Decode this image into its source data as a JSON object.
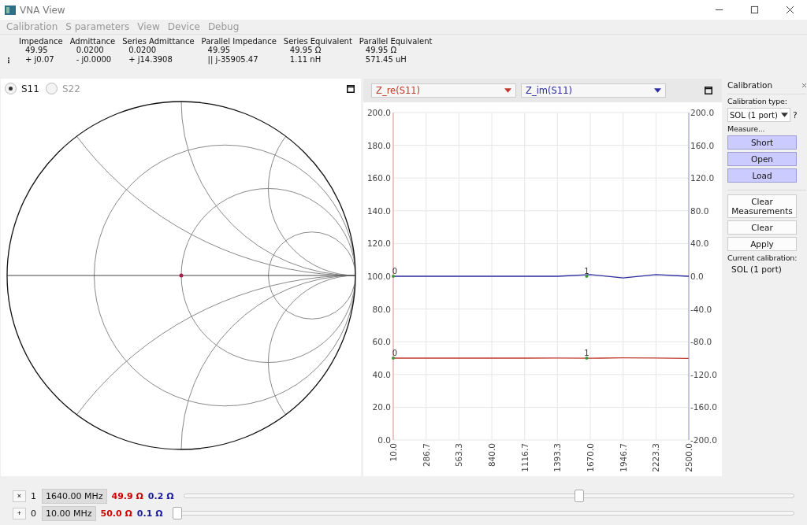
{
  "window": {
    "title": "VNA View"
  },
  "menu": [
    "Calibration",
    "S parameters",
    "View",
    "Device",
    "Debug"
  ],
  "readout": {
    "handle": "⋮",
    "columns": [
      {
        "header": "Impedance",
        "line_1": "49.95",
        "line_2": "+ j0.07"
      },
      {
        "header": "Admittance",
        "line_1": "0.0200",
        "line_2": "- j0.0000"
      },
      {
        "header": "Series Admittance",
        "line_1": "0.0200",
        "line_2": "+ j14.3908"
      },
      {
        "header": "Parallel Impedance",
        "line_1": "49.95",
        "line_2": "|| j-35905.47"
      },
      {
        "header": "Series Equivalent",
        "line_1": "49.95 Ω",
        "line_2": "1.11 nH"
      },
      {
        "header": "Parallel Equivalent",
        "line_1": "49.95 Ω",
        "line_2": "571.45 uH"
      }
    ]
  },
  "smith": {
    "ports": [
      {
        "label": "S11",
        "selected": true
      },
      {
        "label": "S22",
        "selected": false
      }
    ]
  },
  "graph": {
    "real_plot": {
      "chart_data": {
        "type": "line",
        "grid": true,
        "x": [
          10,
          286.7,
          563.3,
          840,
          1116.7,
          1393.3,
          1670,
          1946.7,
          2223.3,
          2500
        ],
        "xticks": [
          {
            "value": 10,
            "label": "10.0"
          },
          {
            "value": 286.7,
            "label": "286.7"
          },
          {
            "value": 563.3,
            "label": "563.3"
          },
          {
            "value": 840,
            "label": "840.0"
          },
          {
            "value": 1116.7,
            "label": "1116.7"
          },
          {
            "value": 1393.3,
            "label": "1393.3"
          },
          {
            "value": 1670,
            "label": "1670.0"
          },
          {
            "value": 1946.7,
            "label": "1946.7"
          },
          {
            "value": 2223.3,
            "label": "2223.3"
          },
          {
            "value": 2500,
            "label": "2500.0"
          }
        ],
        "xlim": [
          10,
          2500
        ],
        "ylim": [
          0,
          200
        ],
        "yticks": [
          {
            "value": 0,
            "label": "0.0"
          },
          {
            "value": 20,
            "label": "20.0"
          },
          {
            "value": 40,
            "label": "40.0"
          },
          {
            "value": 60,
            "label": "60.0"
          },
          {
            "value": 80,
            "label": "80.0"
          },
          {
            "value": 100,
            "label": "100.0"
          },
          {
            "value": 120,
            "label": "120.0"
          },
          {
            "value": 140,
            "label": "140.0"
          },
          {
            "value": 160,
            "label": "160.0"
          },
          {
            "value": 180,
            "label": "180.0"
          },
          {
            "value": 200,
            "label": "200.0"
          }
        ],
        "series": [
          {
            "name": "Z_re(S11)",
            "color": "#c0392b",
            "values": [
              50,
              50,
              50,
              50,
              50,
              50.1,
              49.9,
              50.2,
              50.1,
              49.8
            ]
          }
        ],
        "annotations": [
          {
            "x": 10,
            "y": 50,
            "text": "0"
          },
          {
            "x": 1640,
            "y": 50,
            "text": "1"
          }
        ]
      }
    },
    "imag_plot": {
      "chart_data": {
        "type": "line",
        "x": [
          10,
          286.7,
          563.3,
          840,
          1116.7,
          1393.3,
          1670,
          1946.7,
          2223.3,
          2500
        ],
        "xlim": [
          10,
          2500
        ],
        "ylim": [
          -200,
          200
        ],
        "yticks": [
          {
            "value": 200,
            "label": "200.0"
          },
          {
            "value": 160,
            "label": "160.0"
          },
          {
            "value": 120,
            "label": "120.0"
          },
          {
            "value": 80,
            "label": "80.0"
          },
          {
            "value": 40,
            "label": "40.0"
          },
          {
            "value": 0,
            "label": "0.0"
          },
          {
            "value": -40,
            "label": "-40.0"
          },
          {
            "value": -80,
            "label": "-80.0"
          },
          {
            "value": -120,
            "label": "-120.0"
          },
          {
            "value": -160,
            "label": "-160.0"
          },
          {
            "value": -200,
            "label": "-200.0"
          }
        ],
        "series": [
          {
            "name": "Z_im(S11)",
            "color": "#2c2ca0",
            "values": [
              0,
              0,
              0,
              0,
              0,
              0,
              2,
              -2,
              2,
              0
            ]
          }
        ],
        "annotations": [
          {
            "x": 10,
            "y": 0,
            "text": "0"
          },
          {
            "x": 1640,
            "y": 0,
            "text": "1"
          }
        ]
      }
    }
  },
  "calibration": {
    "title": "Calibration",
    "type_label": "Calibration type:",
    "type_value": "SOL (1 port)",
    "help": "?",
    "measure_label": "Measure...",
    "buttons": [
      {
        "label": "Short",
        "kind": "measure"
      },
      {
        "label": "Open",
        "kind": "measure"
      },
      {
        "label": "Load",
        "kind": "measure"
      },
      {
        "label": "Clear Measurements",
        "kind": "action"
      },
      {
        "label": "Clear",
        "kind": "action"
      },
      {
        "label": "Apply",
        "kind": "action"
      }
    ],
    "current_label": "Current calibration:",
    "current_value": "SOL (1 port)"
  },
  "markers": [
    {
      "toggle": "×",
      "index": "1",
      "frequency": "1640.00 MHz",
      "real": "49.9 Ω",
      "imag": "0.2 Ω",
      "level": 0.65
    },
    {
      "toggle": "+",
      "index": "0",
      "frequency": "10.00 MHz",
      "real": "50.0 Ω",
      "imag": "0.1 Ω",
      "level": 0
    }
  ]
}
